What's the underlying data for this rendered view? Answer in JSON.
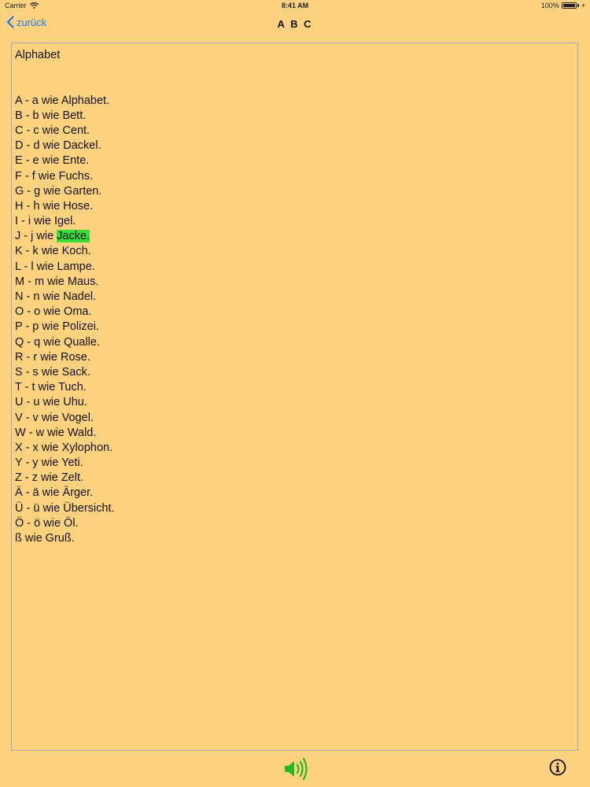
{
  "status": {
    "carrier": "Carrier",
    "time": "8:41 AM",
    "battery": "100%"
  },
  "nav": {
    "back_label": "zurück",
    "title": "A B C"
  },
  "document": {
    "title": "Alphabet",
    "lines": [
      {
        "prefix": "A - a wie ",
        "word": "Alphabet."
      },
      {
        "prefix": "B - b wie ",
        "word": "Bett."
      },
      {
        "prefix": "C - c wie ",
        "word": "Cent."
      },
      {
        "prefix": "D - d wie ",
        "word": "Dackel."
      },
      {
        "prefix": "E - e wie ",
        "word": "Ente."
      },
      {
        "prefix": "F - f wie ",
        "word": "Fuchs."
      },
      {
        "prefix": "G - g wie ",
        "word": "Garten."
      },
      {
        "prefix": "H - h wie ",
        "word": "Hose."
      },
      {
        "prefix": "I - i wie ",
        "word": "Igel."
      },
      {
        "prefix": "J - j wie ",
        "word": "Jacke.",
        "highlighted": true
      },
      {
        "prefix": "K - k wie ",
        "word": "Koch."
      },
      {
        "prefix": "L - l wie ",
        "word": "Lampe."
      },
      {
        "prefix": "M - m wie ",
        "word": "Maus."
      },
      {
        "prefix": "N - n wie ",
        "word": "Nadel."
      },
      {
        "prefix": "O - o wie ",
        "word": "Oma."
      },
      {
        "prefix": "P - p wie ",
        "word": "Polizei."
      },
      {
        "prefix": "Q - q wie ",
        "word": "Qualle."
      },
      {
        "prefix": "R - r wie ",
        "word": "Rose."
      },
      {
        "prefix": "S - s wie ",
        "word": "Sack."
      },
      {
        "prefix": "T - t wie ",
        "word": "Tuch."
      },
      {
        "prefix": "U - u wie ",
        "word": "Uhu."
      },
      {
        "prefix": "V - v wie ",
        "word": "Vogel."
      },
      {
        "prefix": "W - w wie ",
        "word": "Wald."
      },
      {
        "prefix": "X - x wie ",
        "word": "Xylophon."
      },
      {
        "prefix": "Y - y wie ",
        "word": "Yeti."
      },
      {
        "prefix": "Z - z wie ",
        "word": "Zelt."
      },
      {
        "prefix": "Ä - ä wie ",
        "word": "Ärger."
      },
      {
        "prefix": "Ü - ü wie ",
        "word": "Übersicht."
      },
      {
        "prefix": "Ö - ö wie ",
        "word": "Öl."
      },
      {
        "prefix": "ß wie ",
        "word": "Gruß."
      }
    ]
  },
  "toolbar": {
    "speaker_icon": "speaker-icon",
    "info_icon": "info-icon"
  },
  "colors": {
    "background": "#FFD27F",
    "accent": "#1A7BF0",
    "highlight": "#37DD37",
    "speaker": "#22B822"
  }
}
